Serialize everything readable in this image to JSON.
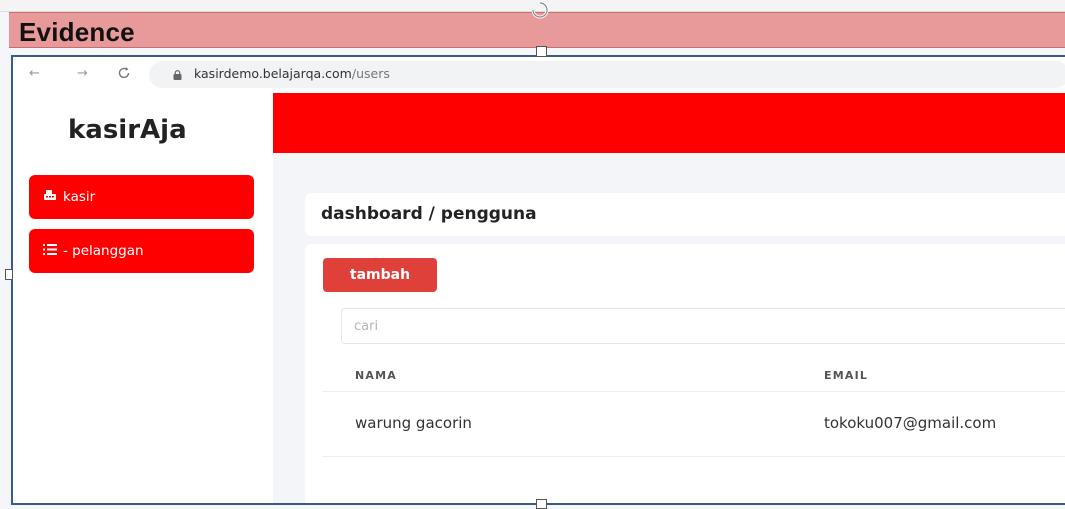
{
  "evidence": {
    "title": "Evidence"
  },
  "browser": {
    "url_host": "kasirdemo.belajarqa.com",
    "url_path": "/users"
  },
  "sidebar": {
    "brand": "kasirAja",
    "items": [
      {
        "label": "kasir",
        "icon": "cash-register-icon"
      },
      {
        "label": "- pelanggan",
        "icon": "list-icon"
      }
    ]
  },
  "page": {
    "breadcrumb": "dashboard / pengguna",
    "add_label": "tambah",
    "search_placeholder": "cari",
    "table": {
      "headers": [
        "NAMA",
        "EMAIL"
      ],
      "rows": [
        [
          "warung gacorin",
          "tokoku007@gmail.com"
        ]
      ]
    }
  },
  "colors": {
    "accent": "#ff0000",
    "add_button": "#e0403a",
    "evidence_banner": "#e89a9a"
  }
}
